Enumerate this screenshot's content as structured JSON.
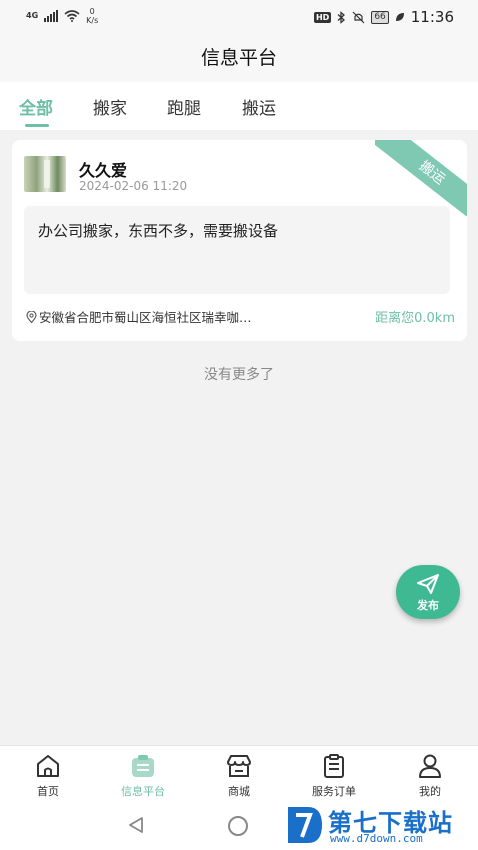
{
  "status_bar": {
    "network_type": "4G",
    "speed_value": "0",
    "speed_unit": "K/s",
    "hd_label": "HD",
    "battery": "66",
    "time": "11:36"
  },
  "header": {
    "title": "信息平台"
  },
  "tabs": [
    {
      "label": "全部",
      "active": true
    },
    {
      "label": "搬家",
      "active": false
    },
    {
      "label": "跑腿",
      "active": false
    },
    {
      "label": "搬运",
      "active": false
    }
  ],
  "posts": [
    {
      "user_name": "久久爱",
      "time": "2024-02-06 11:20",
      "category_badge": "搬运",
      "content": "办公司搬家，东西不多，需要搬设备",
      "location": "安徽省合肥市蜀山区海恒社区瑞幸咖…",
      "distance": "距离您0.0km"
    }
  ],
  "list_end_text": "没有更多了",
  "fab": {
    "label": "发布",
    "icon": "send-icon"
  },
  "bottom_nav": [
    {
      "label": "首页",
      "icon": "home-icon",
      "active": false
    },
    {
      "label": "信息平台",
      "icon": "info-platform-icon",
      "active": true
    },
    {
      "label": "商城",
      "icon": "store-icon",
      "active": false
    },
    {
      "label": "服务订单",
      "icon": "clipboard-icon",
      "active": false
    },
    {
      "label": "我的",
      "icon": "person-icon",
      "active": false
    }
  ],
  "watermark": {
    "main": "第七下载站",
    "sub": "www.d7down.com"
  },
  "colors": {
    "accent": "#6dbfa6",
    "fab": "#3fb992",
    "watermark": "#1a6fc9"
  }
}
